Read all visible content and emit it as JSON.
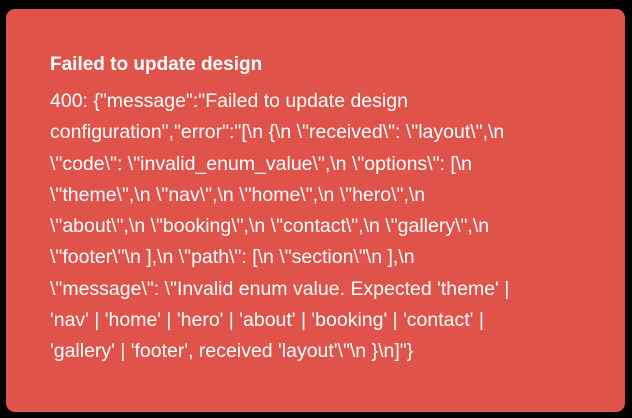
{
  "toast": {
    "title": "Failed to update design",
    "message": "400: {\"message\":\"Failed to update design\nconfiguration\",\"error\":\"[\\n {\\n \\\"received\\\": \\\"layout\\\",\\n\n\\\"code\\\": \\\"invalid_enum_value\\\",\\n \\\"options\\\": [\\n\n\\\"theme\\\",\\n \\\"nav\\\",\\n \\\"home\\\",\\n \\\"hero\\\",\\n\n\\\"about\\\",\\n \\\"booking\\\",\\n \\\"contact\\\",\\n \\\"gallery\\\",\\n\n\\\"footer\\\"\\n ],\\n \\\"path\\\": [\\n \\\"section\\\"\\n ],\\n\n\\\"message\\\": \\\"Invalid enum value. Expected 'theme' |\n'nav' | 'home' | 'hero' | 'about' | 'booking' | 'contact' |\n'gallery' | 'footer', received 'layout'\\\"\\n }\\n]\"}",
    "background_color": "#e0534b"
  }
}
